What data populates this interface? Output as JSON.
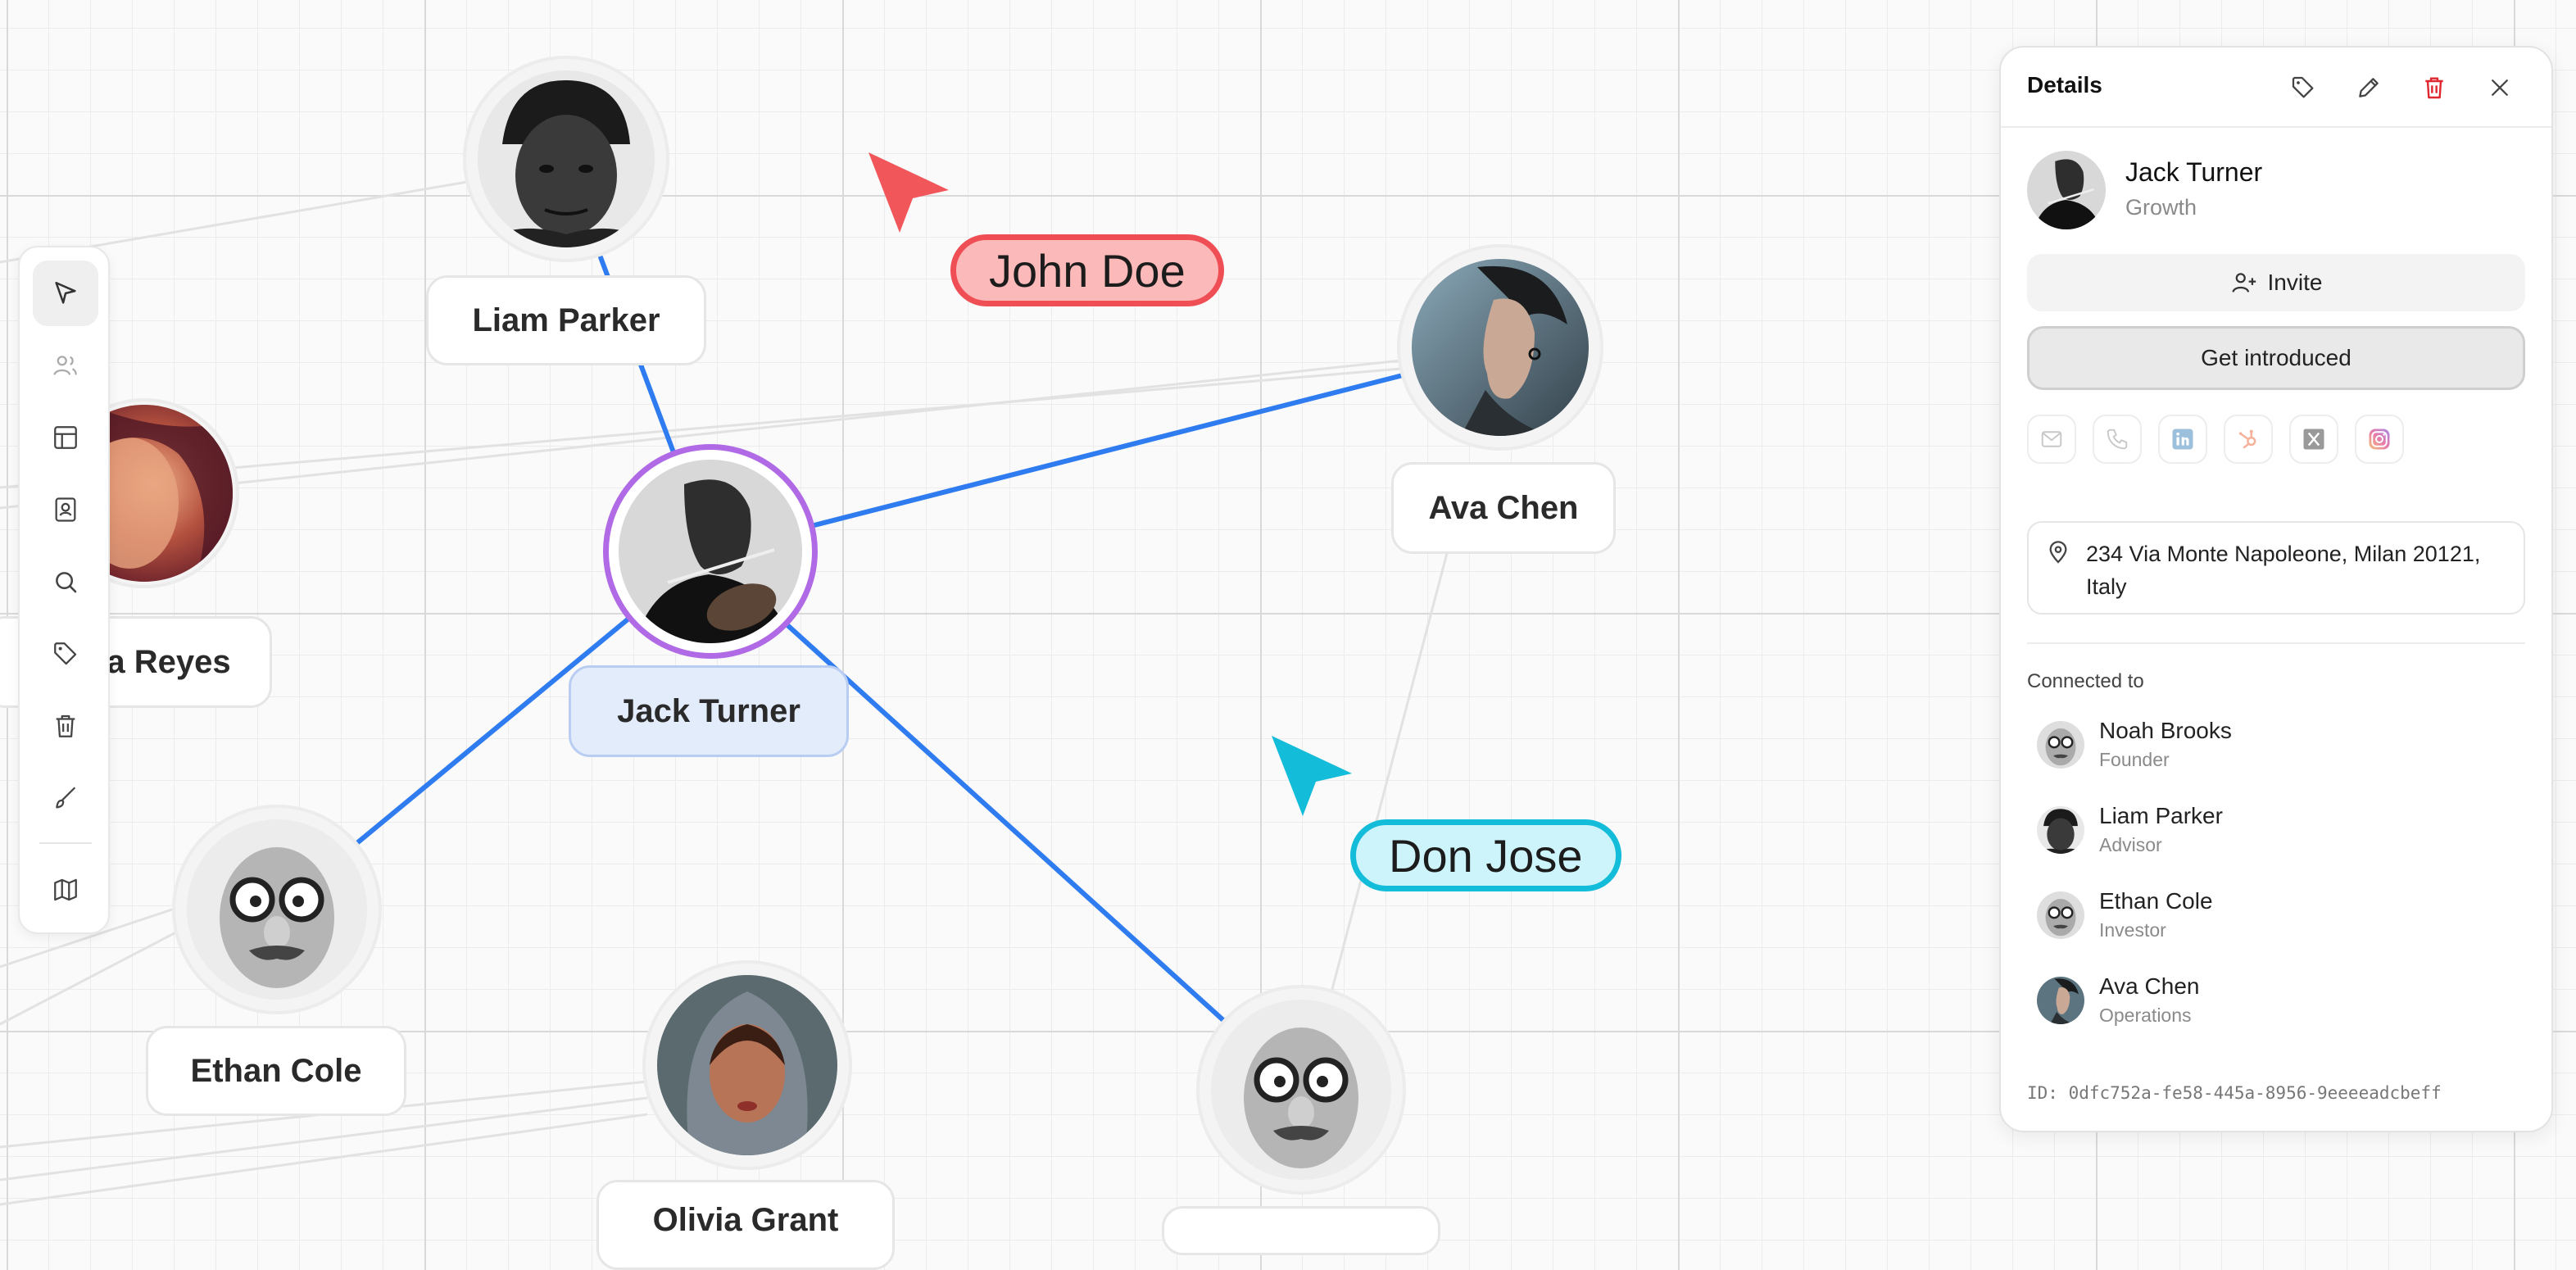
{
  "colors": {
    "edge_active": "#2f7cf0",
    "edge_inactive": "#e2e2e2",
    "selected_ring": "#b06ae6",
    "john_fill": "#fbb9b9",
    "john_stroke": "#ef4e55",
    "don_fill": "#cdf4fa",
    "don_stroke": "#13bcd8",
    "delete_red": "#e0262e"
  },
  "nodes": {
    "liam": {
      "name": "Liam Parker"
    },
    "ava": {
      "name": "Ava Chen"
    },
    "jack": {
      "name": "Jack Turner"
    },
    "reyes": {
      "name": "a Reyes"
    },
    "ethan": {
      "name": "Ethan Cole"
    },
    "olivia": {
      "name": "Olivia Grant"
    }
  },
  "cursors": {
    "john": {
      "label": "John Doe"
    },
    "don": {
      "label": "Don Jose"
    }
  },
  "toolbar": {
    "tools": [
      "select-icon",
      "users-icon",
      "table-icon",
      "contact-card-icon",
      "search-icon",
      "tag-icon",
      "trash-icon",
      "brush-icon",
      "map-icon"
    ]
  },
  "panel": {
    "title": "Details",
    "person": {
      "name": "Jack Turner",
      "role": "Growth"
    },
    "invite_label": "Invite",
    "intro_label": "Get introduced",
    "address": "234 Via Monte Napoleone, Milan 20121, Italy",
    "connected_heading": "Connected to",
    "connections": [
      {
        "name": "Noah Brooks",
        "role": "Founder"
      },
      {
        "name": "Liam Parker",
        "role": "Advisor"
      },
      {
        "name": "Ethan Cole",
        "role": "Investor"
      },
      {
        "name": "Ava Chen",
        "role": "Operations"
      }
    ],
    "id_text": "ID: 0dfc752a-fe58-445a-8956-9eeeeadcbeff"
  }
}
